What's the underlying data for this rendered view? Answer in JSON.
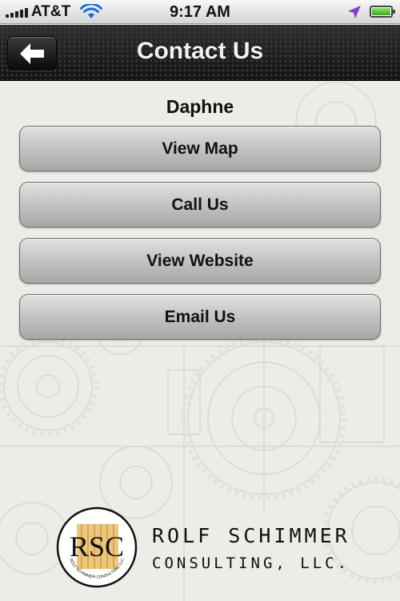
{
  "status_bar": {
    "carrier": "AT&T",
    "time": "9:17 AM",
    "signal_bars": 5,
    "battery_level": 1.0,
    "icons": [
      "signal-icon",
      "wifi-icon",
      "location-arrow-icon",
      "battery-icon"
    ]
  },
  "nav": {
    "title": "Contact Us",
    "back_icon": "arrow-left-icon"
  },
  "location": {
    "name": "Daphne"
  },
  "actions": {
    "view_map": "View Map",
    "call_us": "Call Us",
    "view_website": "View Website",
    "email_us": "Email Us"
  },
  "logo": {
    "initials": "RSC",
    "seal_text": "ROLF SCHIMMER CONSULTING, LLC",
    "name_line": "ROLF SCHIMMER",
    "sub_line": "CONSULTING, LLC."
  },
  "colors": {
    "nav_bg": "#1e1e1e",
    "button_top": "#e0e0e0",
    "button_bottom": "#a6a6a6",
    "background": "#edece7",
    "logo_gold": "#d9a64a"
  }
}
